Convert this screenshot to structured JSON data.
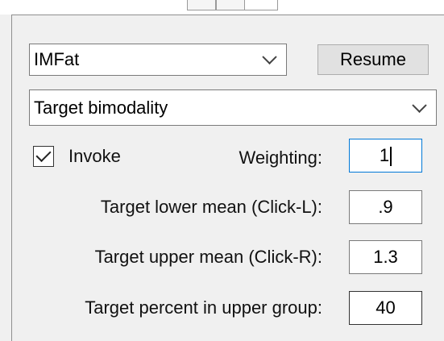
{
  "model_select": {
    "value": "IMFat"
  },
  "resume_button": {
    "label": "Resume"
  },
  "target_select": {
    "value": "Target bimodality"
  },
  "invoke": {
    "label": "Invoke",
    "checked": true
  },
  "weighting": {
    "label": "Weighting:",
    "value": "1"
  },
  "lower_mean": {
    "label": "Target lower mean (Click-L):",
    "value": ".9"
  },
  "upper_mean": {
    "label": "Target upper mean (Click-R):",
    "value": "1.3"
  },
  "upper_pct": {
    "label": "Target percent in upper group:",
    "value": "40"
  },
  "colors": {
    "focus_border": "#0078d7",
    "panel_bg": "#f0f0f0"
  }
}
